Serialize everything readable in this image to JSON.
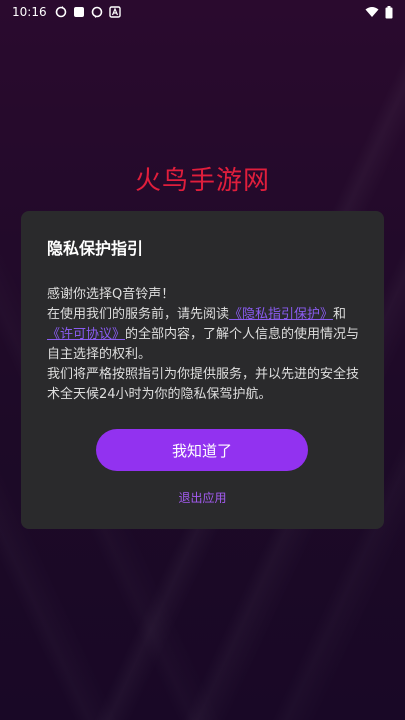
{
  "status_bar": {
    "time": "10:16",
    "icons": [
      "sync-icon",
      "square-notification-icon",
      "sync-icon",
      "a-notification-icon"
    ],
    "right_icons": [
      "wifi-icon",
      "battery-icon"
    ]
  },
  "app": {
    "title": "火鸟手游网"
  },
  "dialog": {
    "title": "隐私保护指引",
    "line1": "感谢你选择Q音铃声！",
    "line2_prefix": "在使用我们的服务前，请先阅读",
    "privacy_link": "《隐私指引保护》",
    "and_text": "和",
    "license_link": "《许可协议》",
    "line2_suffix": "的全部内容，了解个人信息的使用情况与自主选择的权利。",
    "line3": "我们将严格按照指引为你提供服务，并以先进的安全技术全天候24小时为你的隐私保驾护航。",
    "confirm_button": "我知道了",
    "exit_button": "退出应用"
  },
  "colors": {
    "title_red": "#e01e3c",
    "button_purple": "#9232f0",
    "link_purple": "#8a5cf0",
    "dialog_bg": "#2a2a2c"
  }
}
